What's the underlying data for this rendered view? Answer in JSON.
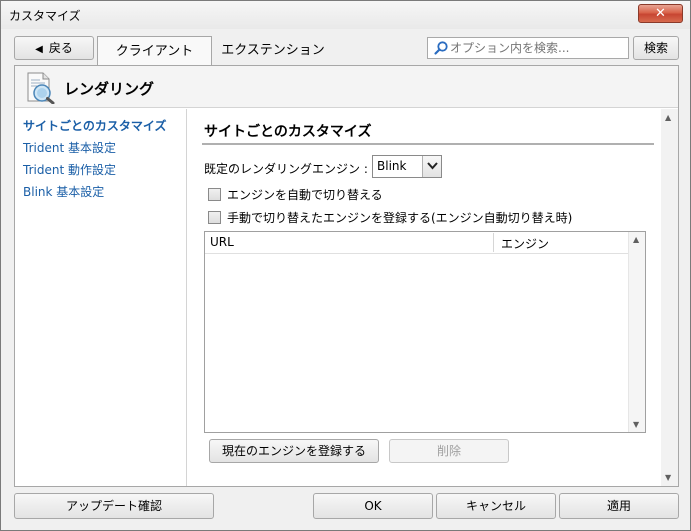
{
  "window": {
    "title": "カスタマイズ",
    "close_glyph": "✕"
  },
  "toolbar": {
    "back_label": "戻る",
    "back_glyph": "◀",
    "tabs": [
      {
        "label": "クライアント",
        "active": true
      },
      {
        "label": "エクステンション",
        "active": false
      }
    ],
    "search_placeholder": "オプション内を検索...",
    "search_button": "検索"
  },
  "header": {
    "title": "レンダリング"
  },
  "sidebar": {
    "items": [
      {
        "label": "サイトごとのカスタマイズ",
        "active": true
      },
      {
        "label": "Trident 基本設定",
        "active": false
      },
      {
        "label": "Trident 動作設定",
        "active": false
      },
      {
        "label": "Blink 基本設定",
        "active": false
      }
    ]
  },
  "main": {
    "section_title": "サイトごとのカスタマイズ",
    "engine_label": "既定のレンダリングエンジン :",
    "engine_value": "Blink",
    "checkboxes": [
      {
        "label": "エンジンを自動で切り替える",
        "checked": false
      },
      {
        "label": "手動で切り替えたエンジンを登録する(エンジン自動切り替え時)",
        "checked": false
      }
    ],
    "table": {
      "columns": [
        "URL",
        "エンジン"
      ],
      "rows": []
    },
    "register_button": "現在のエンジンを登録する",
    "delete_button": "削除"
  },
  "footer": {
    "update_button": "アップデート確認",
    "ok_button": "OK",
    "cancel_button": "キャンセル",
    "apply_button": "適用"
  },
  "colors": {
    "link": "#1b5fa7",
    "close_button": "#c74532"
  }
}
